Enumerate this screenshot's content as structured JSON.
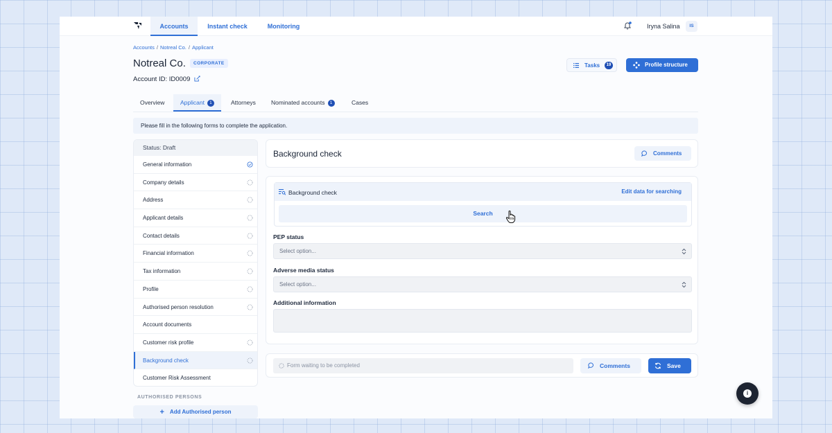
{
  "nav": {
    "tabs": [
      {
        "label": "Accounts",
        "active": true
      },
      {
        "label": "Instant check",
        "active": false
      },
      {
        "label": "Monitoring",
        "active": false
      }
    ],
    "user_name": "Iryna Salina",
    "user_initials": "IS"
  },
  "breadcrumb": [
    "Accounts",
    "Notreal Co.",
    "Applicant"
  ],
  "company": {
    "name": "Notreal Co.",
    "type_badge": "CORPORATE",
    "account_id": "Account ID: ID0009"
  },
  "header_actions": {
    "tasks_label": "Tasks",
    "tasks_count": "19",
    "profile_structure_label": "Profile structure"
  },
  "tabs": [
    {
      "label": "Overview",
      "count": null
    },
    {
      "label": "Applicant",
      "count": "1",
      "active": true
    },
    {
      "label": "Attorneys",
      "count": null
    },
    {
      "label": "Nominated accounts",
      "count": "1"
    },
    {
      "label": "Cases",
      "count": null
    }
  ],
  "banner": "Please fill in the following forms to complete the application.",
  "left_menu": {
    "status": "Status: Draft",
    "items": [
      {
        "label": "General information",
        "state": "done"
      },
      {
        "label": "Company details",
        "state": "pending"
      },
      {
        "label": "Address",
        "state": "pending"
      },
      {
        "label": "Applicant details",
        "state": "pending"
      },
      {
        "label": "Contact details",
        "state": "pending"
      },
      {
        "label": "Financial information",
        "state": "pending"
      },
      {
        "label": "Tax information",
        "state": "pending"
      },
      {
        "label": "Profile",
        "state": "pending"
      },
      {
        "label": "Authorised person resolution",
        "state": "pending"
      },
      {
        "label": "Account documents",
        "state": "none"
      },
      {
        "label": "Customer risk profile",
        "state": "pending"
      },
      {
        "label": "Background check",
        "state": "pending",
        "active": true
      },
      {
        "label": "Customer Risk Assessment",
        "state": "none"
      }
    ],
    "authorised_title": "AUTHORISED PERSONS",
    "add_authorised": "Add Authorised person"
  },
  "form": {
    "title": "Background check",
    "comments_label": "Comments",
    "bg_section_title": "Background check",
    "edit_link": "Edit data for searching",
    "search_label": "Search",
    "pep_label": "PEP status",
    "pep_placeholder": "Select option...",
    "adverse_label": "Adverse media status",
    "adverse_placeholder": "Select option...",
    "additional_label": "Additional information"
  },
  "footer": {
    "waiting_text": "Form waiting to be completed",
    "comments_label": "Comments",
    "save_label": "Save"
  },
  "colors": {
    "accent": "#2f6fd6",
    "badge_dark": "#1f4fb5"
  }
}
